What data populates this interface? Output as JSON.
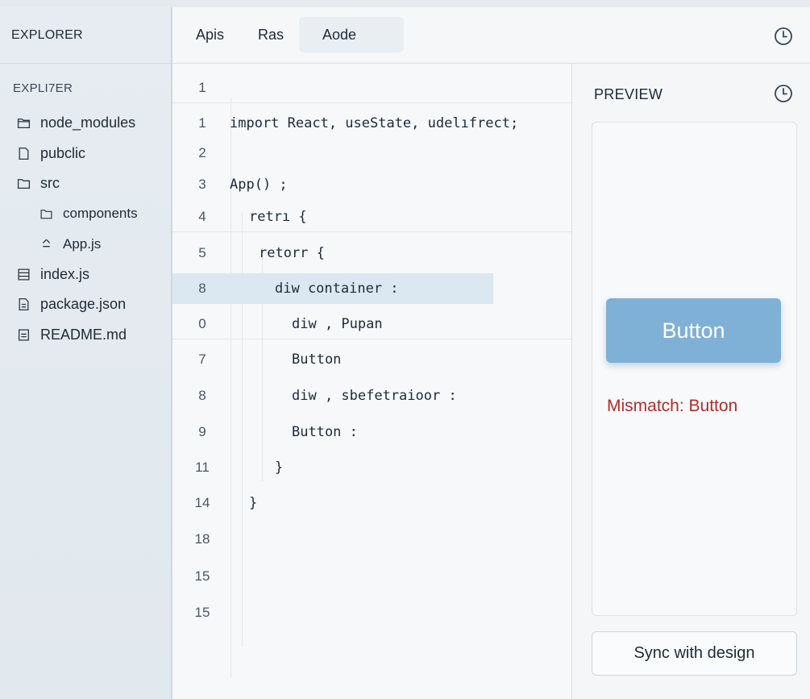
{
  "sidebar": {
    "header": "EXPLORER",
    "subheader": "EXPLI7ER",
    "items": [
      {
        "label": "node_modules",
        "icon": "folder-icon"
      },
      {
        "label": "pubclic",
        "icon": "file-icon"
      },
      {
        "label": "src",
        "icon": "folder-icon"
      },
      {
        "label": "components",
        "icon": "folder-outline-icon"
      },
      {
        "label": "App.js",
        "icon": "react-file-icon"
      },
      {
        "label": "index.js",
        "icon": "file-lines-icon"
      },
      {
        "label": "package.json",
        "icon": "file-lines-icon"
      },
      {
        "label": "README.md",
        "icon": "file-doc-icon"
      }
    ]
  },
  "tabs": [
    "Apis",
    "Ras",
    "Aode"
  ],
  "editor": {
    "lines": [
      {
        "num": "1",
        "text": ""
      },
      {
        "num": "1",
        "text": "import React, useState, udelıfrect;"
      },
      {
        "num": "2",
        "text": ""
      },
      {
        "num": "3",
        "text": "App() ;"
      },
      {
        "num": "4",
        "text": "retrı {"
      },
      {
        "num": "5",
        "text": "retorr {"
      },
      {
        "num": "8",
        "text": "diw container :"
      },
      {
        "num": "0",
        "text": "diw , Pupan"
      },
      {
        "num": "7",
        "text": "Button"
      },
      {
        "num": "8",
        "text": "diw , sbefetraioor :"
      },
      {
        "num": "9",
        "text": "Button :"
      },
      {
        "num": "11",
        "text": "}"
      },
      {
        "num": "14",
        "text": "}"
      },
      {
        "num": "18",
        "text": ""
      },
      {
        "num": "15",
        "text": ""
      },
      {
        "num": "15",
        "text": ""
      }
    ]
  },
  "preview": {
    "title": "PREVIEW",
    "button_label": "Button",
    "mismatch_text": "Mismatch: Button",
    "sync_label": "Sync with design"
  },
  "colors": {
    "accent_button": "#7fb0d6",
    "error": "#b52a2a",
    "highlight_row": "#dbe8f1"
  }
}
